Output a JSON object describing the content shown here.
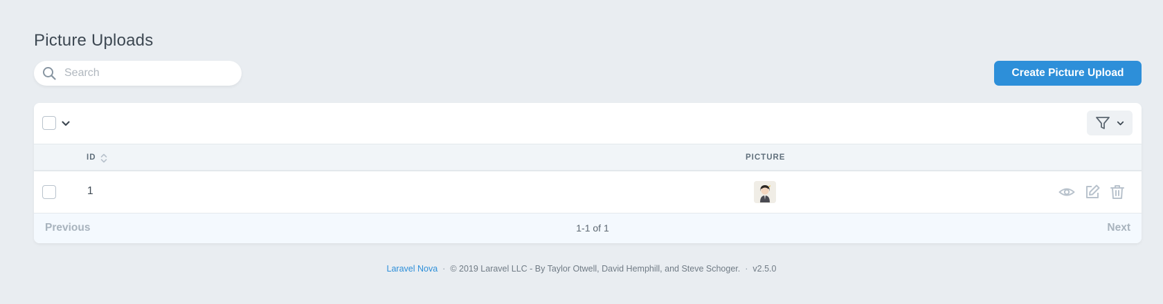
{
  "page": {
    "title": "Picture Uploads"
  },
  "search": {
    "placeholder": "Search",
    "value": "",
    "icon": "search-icon"
  },
  "actions": {
    "create_label": "Create Picture Upload"
  },
  "colors": {
    "accent": "#2d8fd9",
    "background": "#e9edf1",
    "muted": "#a8b3bd"
  },
  "table": {
    "columns": [
      {
        "label": "ID",
        "sortable": true
      },
      {
        "label": "PICTURE",
        "sortable": false
      }
    ],
    "rows": [
      {
        "id": "1",
        "picture": "avatar-thumbnail",
        "actions": [
          "eye-icon",
          "edit-icon",
          "trash-icon"
        ]
      }
    ]
  },
  "pagination": {
    "previous": "Previous",
    "info": "1-1 of 1",
    "next": "Next"
  },
  "footer": {
    "link": "Laravel Nova",
    "copyright": "© 2019 Laravel LLC - By Taylor Otwell, David Hemphill, and Steve Schoger.",
    "version": "v2.5.0"
  }
}
